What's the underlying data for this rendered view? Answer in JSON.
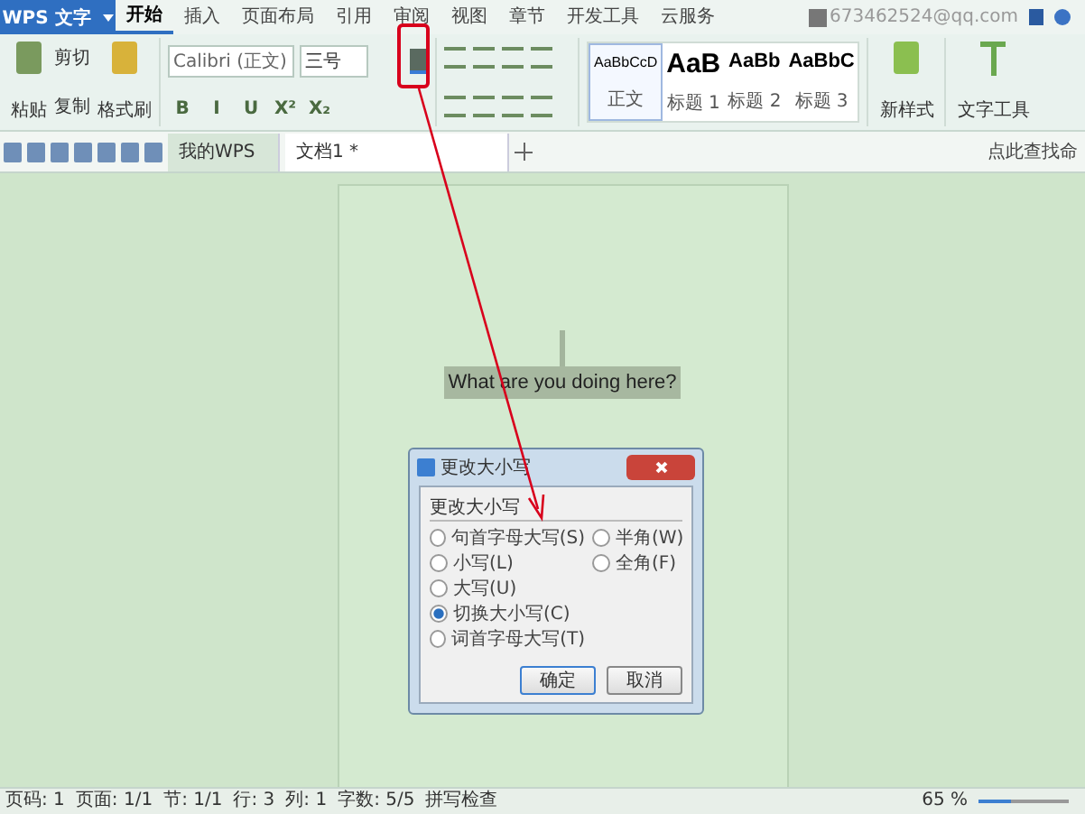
{
  "app_menu": {
    "label": "WPS 文字"
  },
  "ribbon_tabs": [
    {
      "label": "开始",
      "selected": true
    },
    {
      "label": "插入",
      "selected": false
    },
    {
      "label": "页面布局",
      "selected": false
    },
    {
      "label": "引用",
      "selected": false
    },
    {
      "label": "审阅",
      "selected": false
    },
    {
      "label": "视图",
      "selected": false
    },
    {
      "label": "章节",
      "selected": false
    },
    {
      "label": "开发工具",
      "selected": false
    },
    {
      "label": "云服务",
      "selected": false
    }
  ],
  "account": {
    "email": "673462524@qq.com"
  },
  "clipboard": {
    "paste": "粘贴",
    "cut": "剪切",
    "copy": "复制",
    "format_painter": "格式刷"
  },
  "font": {
    "name": "Calibri (正文)",
    "size": "三号"
  },
  "format_buttons": [
    "B",
    "I",
    "U",
    "X²",
    "X₂"
  ],
  "styles": [
    {
      "preview": "AaBbCcD",
      "label": "正文",
      "selected": true
    },
    {
      "preview": "AaB",
      "label": "标题 1",
      "selected": false
    },
    {
      "preview": "AaBb",
      "label": "标题 2",
      "selected": false
    },
    {
      "preview": "AaBbC",
      "label": "标题 3",
      "selected": false
    }
  ],
  "new_style": "新样式",
  "text_tools": "文字工具",
  "doc_tabs": [
    {
      "label": "我的WPS",
      "selected": false
    },
    {
      "label": "文档1 *",
      "selected": true
    }
  ],
  "search": {
    "placeholder": "点此查找命"
  },
  "document": {
    "text": "What are you doing here?"
  },
  "dialog": {
    "title": "更改大小写",
    "group": "更改大小写",
    "options": [
      {
        "label": "句首字母大写(S)",
        "selected": false
      },
      {
        "label": "小写(L)",
        "selected": false
      },
      {
        "label": "大写(U)",
        "selected": false
      },
      {
        "label": "切换大小写(C)",
        "selected": true
      },
      {
        "label": "词首字母大写(T)",
        "selected": false
      }
    ],
    "width_options": [
      {
        "label": "半角(W)",
        "selected": false
      },
      {
        "label": "全角(F)",
        "selected": false
      }
    ],
    "buttons": [
      "确定",
      "取消"
    ]
  },
  "status_bar": [
    "页码: 1",
    "页面: 1/1",
    "节: 1/1",
    "行: 3",
    "列: 1",
    "字数: 5/5",
    "拼写检查"
  ],
  "zoom": {
    "reading": "65 %",
    "level": 0.35
  }
}
